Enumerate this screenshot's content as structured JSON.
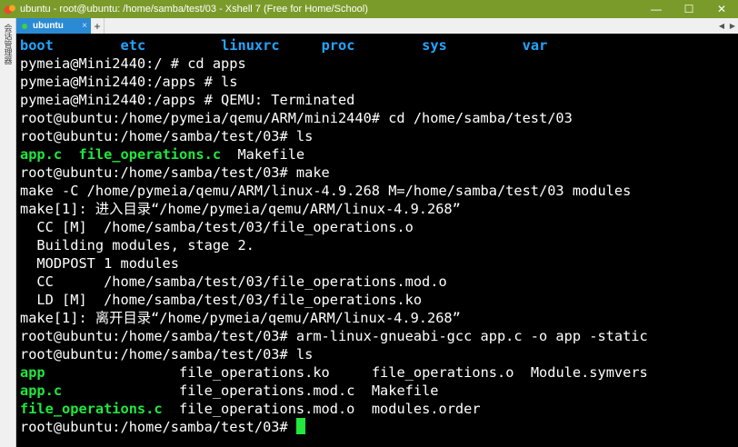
{
  "window": {
    "title": "ubuntu - root@ubuntu: /home/samba/test/03 - Xshell 7 (Free for Home/School)",
    "controls": [
      "—",
      "☐",
      "✕"
    ]
  },
  "tabs": [
    {
      "label": "ubuntu",
      "close": "×"
    }
  ],
  "tabbar": {
    "add": "+",
    "prev": "◀",
    "next": "▶"
  },
  "sidebar": {
    "label": "会话管理器"
  },
  "colors": {
    "titlebar": "#7a9b2a",
    "tab": "#2a8ad4",
    "dir": "#22a6ff",
    "exec": "#22e63e"
  },
  "terminal": {
    "ls_root": [
      "boot",
      "etc",
      "linuxrc",
      "proc",
      "sys",
      "var"
    ],
    "l1": "pymeia@Mini2440:/ # cd apps",
    "l2": "pymeia@Mini2440:/apps # ls",
    "l3": "pymeia@Mini2440:/apps # QEMU: Terminated",
    "l4": "root@ubuntu:/home/pymeia/qemu/ARM/mini2440# cd /home/samba/test/03",
    "l5": "root@ubuntu:/home/samba/test/03# ls",
    "ls1": {
      "app_c": "app.c",
      "file_ops": "file_operations.c",
      "makefile": "Makefile"
    },
    "l7": "root@ubuntu:/home/samba/test/03# make",
    "l8": "make -C /home/pymeia/qemu/ARM/linux-4.9.268 M=/home/samba/test/03 modules",
    "l9": "make[1]: 进入目录“/home/pymeia/qemu/ARM/linux-4.9.268”",
    "l10": "  CC [M]  /home/samba/test/03/file_operations.o",
    "l11": "  Building modules, stage 2.",
    "l12": "  MODPOST 1 modules",
    "l13": "  CC      /home/samba/test/03/file_operations.mod.o",
    "l14": "  LD [M]  /home/samba/test/03/file_operations.ko",
    "l15": "make[1]: 离开目录“/home/pymeia/qemu/ARM/linux-4.9.268”",
    "l16": "root@ubuntu:/home/samba/test/03# arm-linux-gnueabi-gcc app.c -o app -static",
    "l17": "root@ubuntu:/home/samba/test/03# ls",
    "ls2": {
      "app": "app",
      "ko": "file_operations.ko",
      "o": "file_operations.o",
      "symvers": "Module.symvers",
      "app_c": "app.c",
      "mod_c": "file_operations.mod.c",
      "makefile": "Makefile",
      "file_ops": "file_operations.c",
      "mod_o": "file_operations.mod.o",
      "order": "modules.order"
    },
    "prompt": "root@ubuntu:/home/samba/test/03# "
  }
}
